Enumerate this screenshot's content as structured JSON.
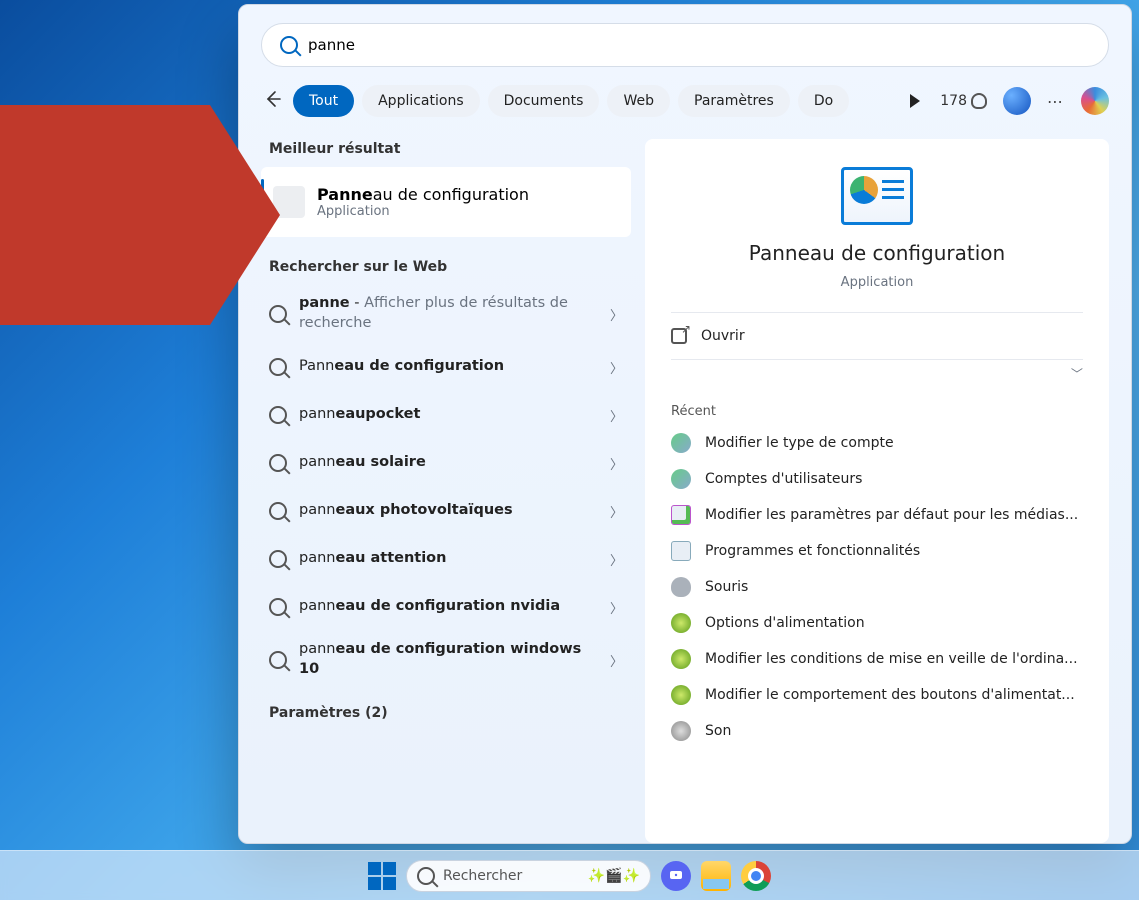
{
  "search": {
    "query": "panne",
    "placeholder": ""
  },
  "filters": {
    "items": [
      {
        "label": "Tout",
        "active": true
      },
      {
        "label": "Applications",
        "active": false
      },
      {
        "label": "Documents",
        "active": false
      },
      {
        "label": "Web",
        "active": false
      },
      {
        "label": "Paramètres",
        "active": false
      },
      {
        "label": "Do",
        "active": false
      }
    ]
  },
  "rewards": {
    "points": "178"
  },
  "left": {
    "best_label": "Meilleur résultat",
    "best": {
      "prefix": "Panne",
      "suffix": "au de configuration",
      "subtitle": "Application"
    },
    "web_label": "Rechercher sur le Web",
    "suggestions": [
      {
        "prefix": "panne",
        "rest": " - ",
        "dim": "Afficher plus de résultats de recherche",
        "bold": ""
      },
      {
        "prefix": "Pann",
        "rest": "",
        "dim": "",
        "bold": "eau de configuration"
      },
      {
        "prefix": "pann",
        "rest": "",
        "dim": "",
        "bold": "eaupocket"
      },
      {
        "prefix": "pann",
        "rest": "",
        "dim": "",
        "bold": "eau solaire"
      },
      {
        "prefix": "pann",
        "rest": "",
        "dim": "",
        "bold": "eaux photovoltaïques"
      },
      {
        "prefix": "pann",
        "rest": "",
        "dim": "",
        "bold": "eau attention"
      },
      {
        "prefix": "pann",
        "rest": "",
        "dim": "",
        "bold": "eau de configuration nvidia"
      },
      {
        "prefix": "pann",
        "rest": "",
        "dim": "",
        "bold": "eau de configuration windows 10"
      }
    ],
    "params_label": "Paramètres (2)"
  },
  "detail": {
    "title": "Panneau de configuration",
    "subtitle": "Application",
    "open_label": "Ouvrir",
    "recent_label": "Récent",
    "recent": [
      "Modifier le type de compte",
      "Comptes d'utilisateurs",
      "Modifier les paramètres par défaut pour les médias...",
      "Programmes et fonctionnalités",
      "Souris",
      "Options d'alimentation",
      "Modifier les conditions de mise en veille de l'ordina...",
      "Modifier le comportement des boutons d'alimentat...",
      "Son"
    ]
  },
  "taskbar": {
    "search_placeholder": "Rechercher"
  }
}
